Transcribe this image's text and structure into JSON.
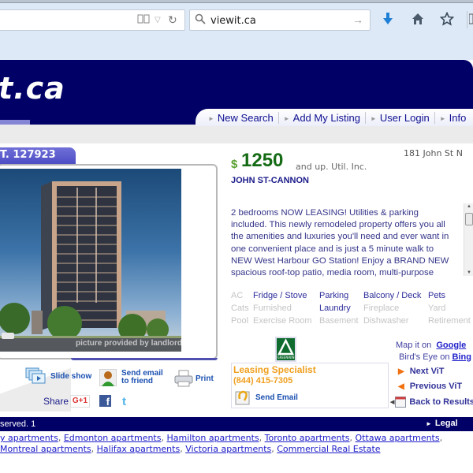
{
  "browser": {
    "search_query": "viewit.ca",
    "icons": [
      "reader-view-icon",
      "dropdown-icon",
      "reload-icon",
      "search-icon",
      "go-arrow-icon",
      "download-icon",
      "home-icon",
      "bookmark-star-icon",
      "library-icon"
    ]
  },
  "site": {
    "logo_text": "t.ca",
    "nav": [
      {
        "label": "New Search"
      },
      {
        "label": "Add My Listing"
      },
      {
        "label": "User Login"
      },
      {
        "label": "Info"
      }
    ]
  },
  "listing": {
    "id_tab": "T. 127923",
    "photo_caption": "picture provided by landlord",
    "price_symbol": "$",
    "price": "1250",
    "price_note": "and up.  Util. Inc.",
    "address": "181 John St N",
    "building_name": "JOHN ST-CANNON",
    "description": "2 bedrooms NOW LEASING! Utilities & parking included. This newly remodeled property offers you all the amenities and luxuries you'll need and ever want in one convenient place and is just a 5 minute walk to NEW West Harbour GO Station! Enjoy a BRAND NEW spacious roof-top patio, media room, multi-purpose room,",
    "amenities": [
      [
        {
          "label": "AC",
          "available": false
        },
        {
          "label": "Fridge / Stove",
          "available": true
        },
        {
          "label": "Parking",
          "available": true
        },
        {
          "label": "Balcony / Deck",
          "available": true
        },
        {
          "label": "Pets",
          "available": true
        }
      ],
      [
        {
          "label": "Cats",
          "available": false
        },
        {
          "label": "Furnished",
          "available": false
        },
        {
          "label": "Laundry",
          "available": true
        },
        {
          "label": "Fireplace",
          "available": false
        },
        {
          "label": "Yard",
          "available": false
        }
      ],
      [
        {
          "label": "Pool",
          "available": false
        },
        {
          "label": "Exercise Room",
          "available": false
        },
        {
          "label": "Basement",
          "available": false
        },
        {
          "label": "Dishwasher",
          "available": false
        },
        {
          "label": "Retirement",
          "available": false
        }
      ]
    ]
  },
  "actions": {
    "slideshow": "Slide show",
    "send_email_friend_1": "Send email",
    "send_email_friend_2": "to friend",
    "print": "Print",
    "share": "Share",
    "gplus": "G+1",
    "facebook": "f",
    "twitter": "t"
  },
  "contact": {
    "company_logo_text": "GREENWIN",
    "title": "Leasing Specialist",
    "phone": "(844) 415-7305",
    "send_email": "Send Email"
  },
  "map": {
    "map_prefix": "Map it on",
    "map_link": "Google",
    "birds_prefix": "Bird's Eye on",
    "birds_link": "Bing"
  },
  "navigation": {
    "next": "Next ViT",
    "previous": "Previous ViT",
    "back": "Back to Results"
  },
  "footer": {
    "copyright": "served.  1",
    "legal": "Legal",
    "cities": [
      "y apartments",
      "Edmonton apartments",
      "Hamilton apartments",
      "Toronto apartments",
      "Ottawa apartments",
      "Montreal apartments",
      "Halifax apartments",
      "Victoria apartments",
      "Commercial Real Estate"
    ]
  },
  "colors": {
    "brand_navy": "#000066",
    "price_green": "#156b15",
    "leasing_orange": "#f0a020",
    "link_blue": "#1a1ac8"
  }
}
